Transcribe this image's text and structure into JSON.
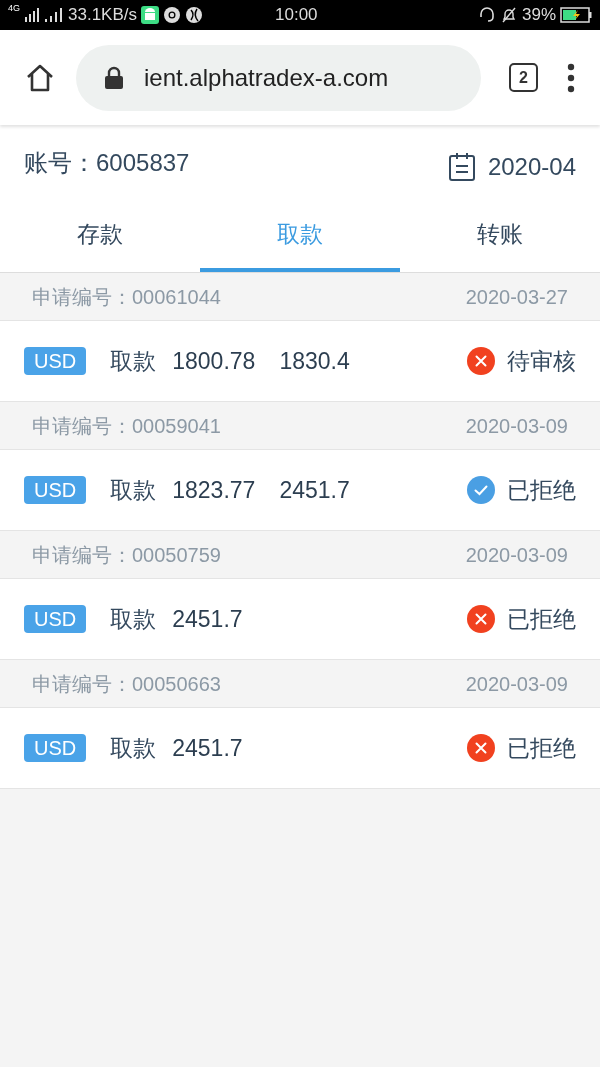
{
  "status_bar": {
    "network": "4G",
    "speed": "33.1KB/s",
    "time": "10:00",
    "battery": "39%"
  },
  "browser": {
    "url": "ient.alphatradex-a.com",
    "tab_count": "2"
  },
  "account": {
    "label": "账号：6005837",
    "month": "2020-04"
  },
  "tabs": [
    {
      "label": "存款",
      "selected": false
    },
    {
      "label": "取款",
      "selected": true
    },
    {
      "label": "转账",
      "selected": false
    }
  ],
  "records": [
    {
      "request_no": "申请编号：00061044",
      "date": "2020-03-27",
      "currency": "USD",
      "type": "取款",
      "amounts": [
        "1800.78",
        "1830.4"
      ],
      "kind": "cross",
      "status": "待审核"
    },
    {
      "request_no": "申请编号：00059041",
      "date": "2020-03-09",
      "currency": "USD",
      "type": "取款",
      "amounts": [
        "1823.77",
        "2451.7"
      ],
      "kind": "check",
      "status": "已拒绝"
    },
    {
      "request_no": "申请编号：00050759",
      "date": "2020-03-09",
      "currency": "USD",
      "type": "取款",
      "amounts": [
        "2451.7"
      ],
      "kind": "cross",
      "status": "已拒绝"
    },
    {
      "request_no": "申请编号：00050663",
      "date": "2020-03-09",
      "currency": "USD",
      "type": "取款",
      "amounts": [
        "2451.7"
      ],
      "kind": "cross",
      "status": "已拒绝"
    }
  ]
}
